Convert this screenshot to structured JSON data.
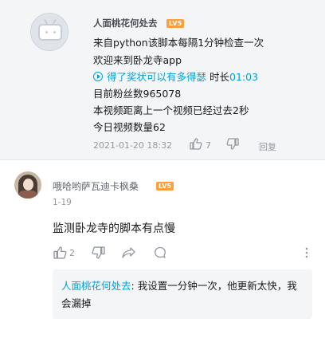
{
  "top_reply": {
    "username": "人面桃花何处去",
    "level": "LV5",
    "lines": [
      "来自python该脚本每隔1分钟检查一次",
      "欢迎来到卧龙寺app"
    ],
    "video_link": {
      "title": "得了奖状可以有多得瑟",
      "duration_label": "时长",
      "duration": "01:03"
    },
    "lines_after": [
      "目前粉丝数965078",
      "本视频距离上一个视频已经过去2秒",
      "今日视频数量62"
    ],
    "timestamp": "2021-01-20 18:32",
    "like_count": "7",
    "reply_label": "回复"
  },
  "comment": {
    "username": "哦哈哟萨瓦迪卡枫桑",
    "level": "LV5",
    "date": "1-19",
    "content": "监测卧龙寺的脚本有点慢",
    "like_count": "2",
    "more_icon": "more-vertical-icon",
    "sub_reply": {
      "mention": "人面桃花何处去",
      "separator": ": ",
      "text": "我设置一分钟一次，他更新太快，我会漏掉"
    }
  },
  "colors": {
    "accent": "#00a1d6",
    "level_badge": "#ff9e3d",
    "muted": "#9499a0",
    "card_bg": "#f4f5f7"
  }
}
